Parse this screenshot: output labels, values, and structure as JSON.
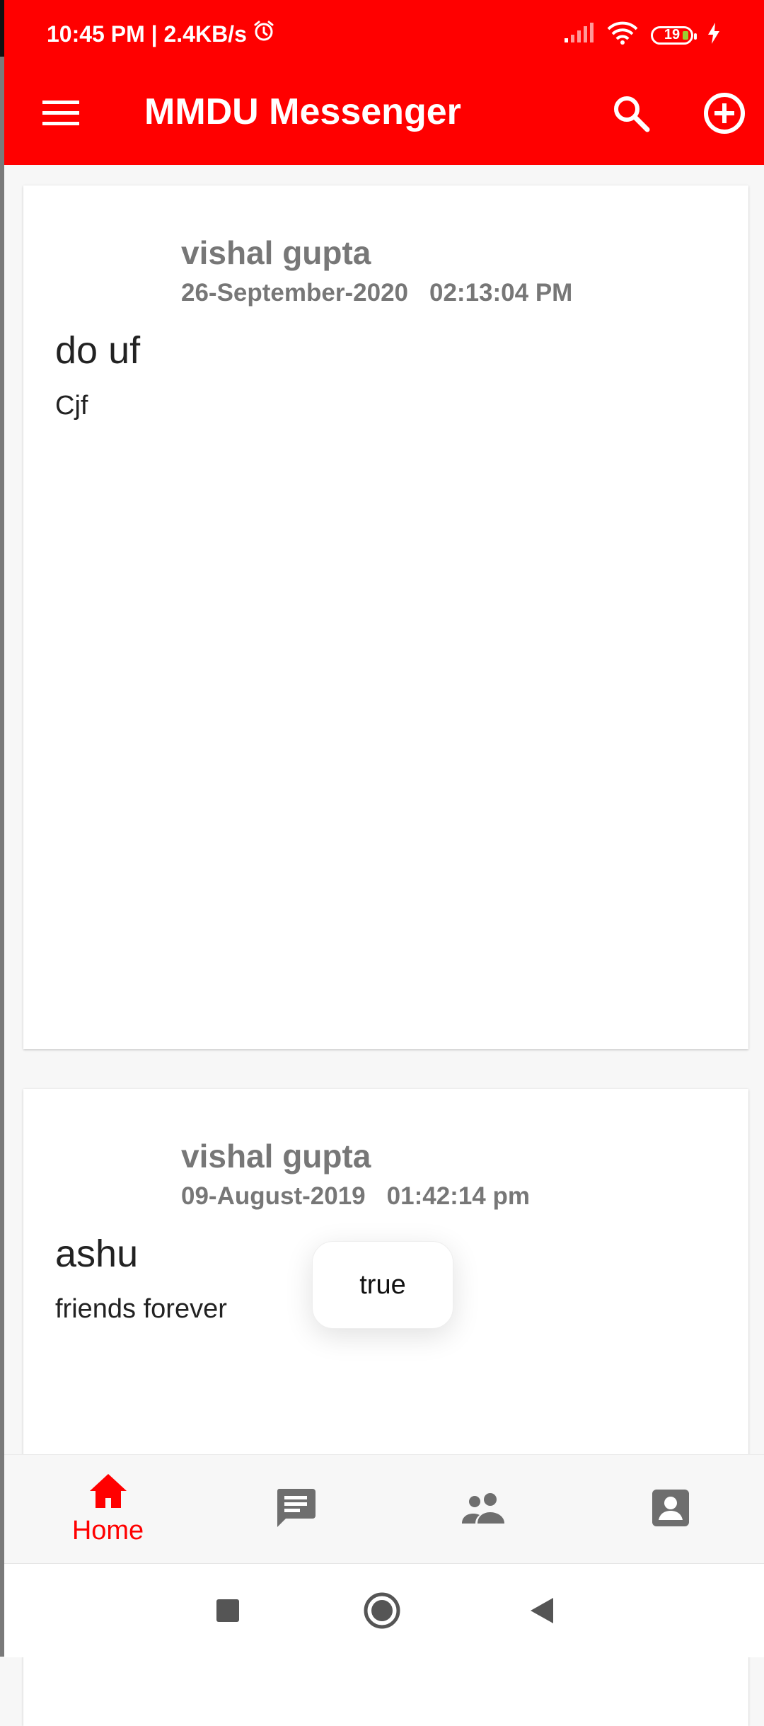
{
  "status_bar": {
    "left_text": "10:45 PM | 2.4KB/s",
    "battery": "19"
  },
  "app_bar": {
    "title": "MMDU Messenger",
    "icons": [
      "menu-icon",
      "search-icon",
      "add-circle-icon"
    ]
  },
  "posts": [
    {
      "author": "vishal gupta",
      "date": "26-September-2020",
      "time": "02:13:04 PM",
      "subject": "do uf",
      "body": "Cjf"
    },
    {
      "author": "vishal gupta",
      "date": "09-August-2019",
      "time": "01:42:14 pm",
      "subject": "ashu",
      "body": "friends forever"
    }
  ],
  "toast": {
    "text": "true"
  },
  "bottom_nav": {
    "items": [
      {
        "label": "Home",
        "icon": "home-icon",
        "active": true
      },
      {
        "icon": "chat-icon"
      },
      {
        "icon": "people-icon"
      },
      {
        "icon": "profile-icon"
      }
    ]
  },
  "colors": {
    "primary": "#ff0000",
    "muted_text": "#777777",
    "icon_gray": "#6e6e6e"
  }
}
